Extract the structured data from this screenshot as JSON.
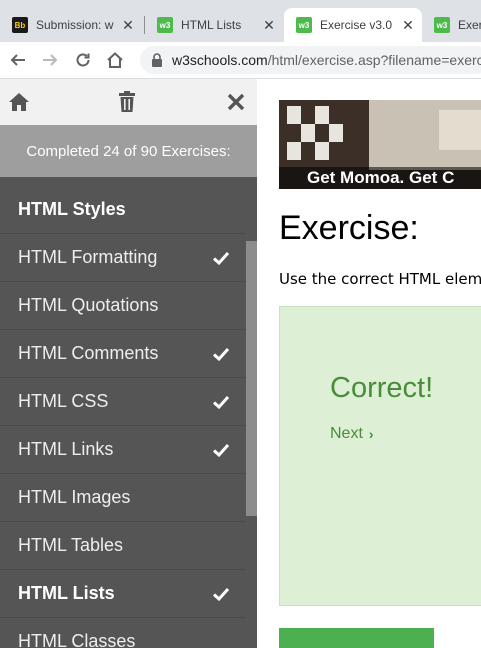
{
  "browser": {
    "tabs": [
      {
        "label": "Submission: w",
        "favicon": "Bb"
      },
      {
        "label": "HTML Lists",
        "favicon": "w3"
      },
      {
        "label": "Exercise v3.0",
        "favicon": "w3"
      },
      {
        "label": "Exer",
        "favicon": "w3"
      }
    ],
    "close_glyph": "✕",
    "url_host": "w3schools.com",
    "url_path": "/html/exercise.asp?filename=exerci"
  },
  "sidebar": {
    "progress": "Completed 24 of 90 Exercises:",
    "items": [
      {
        "label": "HTML Styles",
        "bold": true,
        "checked": false
      },
      {
        "label": "HTML Formatting",
        "bold": false,
        "checked": true
      },
      {
        "label": "HTML Quotations",
        "bold": false,
        "checked": false
      },
      {
        "label": "HTML Comments",
        "bold": false,
        "checked": true
      },
      {
        "label": "HTML CSS",
        "bold": false,
        "checked": true
      },
      {
        "label": "HTML Links",
        "bold": false,
        "checked": true
      },
      {
        "label": "HTML Images",
        "bold": false,
        "checked": false
      },
      {
        "label": "HTML Tables",
        "bold": false,
        "checked": false
      },
      {
        "label": "HTML Lists",
        "bold": true,
        "checked": true
      },
      {
        "label": "HTML Classes",
        "bold": false,
        "checked": false
      }
    ]
  },
  "main": {
    "ad_text": "Get Momoa. Get C",
    "title": "Exercise:",
    "description": "Use the correct HTML elem",
    "result": {
      "status": "Correct!",
      "next_label": "Next",
      "next_glyph": "›"
    }
  },
  "colors": {
    "sidebar_bg": "#555555",
    "accent_green": "#4caf50",
    "correct_text": "#4a8c3a",
    "result_bg": "#ddf0d6"
  }
}
